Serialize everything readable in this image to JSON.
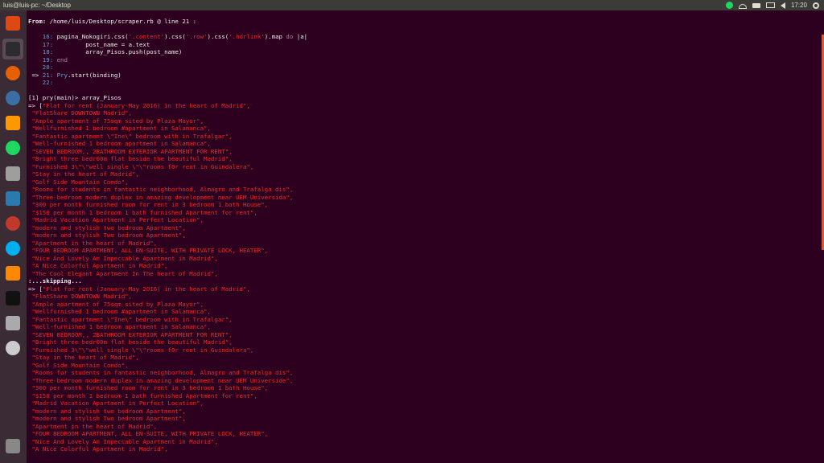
{
  "window": {
    "title": "luis@luis-pc: ~/Desktop"
  },
  "tray": {
    "clock": "17:20",
    "icons": [
      "spotify-icon",
      "wifi-icon",
      "keyboard-icon",
      "battery-icon",
      "volume-icon",
      "gear-icon"
    ]
  },
  "launcher": {
    "items": [
      {
        "name": "ubuntu-dash-icon",
        "color": "#dd4814"
      },
      {
        "name": "terminal-icon",
        "color": "#2c2c2c"
      },
      {
        "name": "firefox-icon",
        "color": "#e66000"
      },
      {
        "name": "thunderbird-icon",
        "color": "#3b6ea5"
      },
      {
        "name": "sublime-text-icon",
        "color": "#ff9800"
      },
      {
        "name": "spotify-icon",
        "color": "#1ed760"
      },
      {
        "name": "files-icon",
        "color": "#9e9e9e"
      },
      {
        "name": "libreoffice-writer-icon",
        "color": "#2a7ab0"
      },
      {
        "name": "settings-icon",
        "color": "#c0392b"
      },
      {
        "name": "skype-icon",
        "color": "#00aff0"
      },
      {
        "name": "vlc-icon",
        "color": "#ff8800"
      },
      {
        "name": "inkscape-icon",
        "color": "#111111"
      },
      {
        "name": "drive-icon",
        "color": "#aaaaaa"
      },
      {
        "name": "dvd-icon",
        "color": "#cccccc"
      },
      {
        "name": "trash-icon",
        "color": "#888888"
      }
    ]
  },
  "terminal": {
    "from_label": "From: ",
    "from_path": "/home/luis/Desktop/scraper.rb @ line 21 :",
    "code": [
      {
        "num": "    16:",
        "a": " pagina_Nokogiri.css(",
        "s1": "'.content'",
        "b": ").css(",
        "s2": "'.row'",
        "c": ").css(",
        "s3": "'.hdrlink'",
        "d": ").map ",
        "kw": "do",
        "e": " |a|"
      },
      {
        "num": "    17:",
        "text": "         post_name = a.text"
      },
      {
        "num": "    18:",
        "text": "         array_Pisos.push(post_name)"
      },
      {
        "num": "    19:",
        "kwonly": " end"
      },
      {
        "num": "    20:",
        "text": ""
      },
      {
        "arrow": " => ",
        "num": "21:",
        "call": " Pry",
        "rest": ".start(binding)"
      },
      {
        "num": "    22:",
        "text": ""
      }
    ],
    "prompt": "[1] pry(main)> array_Pisos",
    "result_open": "=> [",
    "skipping": ":...skipping...",
    "items_first": [
      "\"Flat for rent (January-May 2016) in the heart of Madrid\",",
      " \"FlatShare DOWNTOWN Madrid\",",
      " \"Ample apartment of 75sqm sited by Plaza Mayor\",",
      " \"Wellfurnished 1 bedroom #apartment in Salamanca\",",
      " \"Fantastic apartment \\\"Ine\\\" bedroom with in Trafalgar\",",
      " \"Well-furnished 1 bedroom apartment in Salamanca\",",
      " \"SEVEN BEDROOM,, 2BATHROOM EXTERIOR APARTMENT FOR RENT\",",
      " \"Bright three bedr00m flat beside the beautiful Madrid\",",
      " \"Furnished 3\\\"\\\"well single \\\"\\\"rooms f0r rent in Guindalera\",",
      " \"Stay in the heart of Madrid\",",
      " \"Golf Side Mountain Condo\",",
      " \"Rooms for students in fantastic neighborhood, Almagro and Trafalga dis\",",
      " \"Three-bedroom modern duplex in amazing development near UEM Universida\",",
      " \"300 per month furnished room for rent in 3 bedroom 1 bath House\",",
      " \"$150 per month 1 bedroom 1 bath furnished Apartment for rent\",",
      " \"Madrid Vacation Apartment in Perfect Location\",",
      " \"modern and stylish two bedroom Apartment\",",
      " \"modern and stylish Two bedroom Apartment\",",
      " \"Apartment in the heart of Madrid\",",
      " \"FOUR BEDROOM APARTMENT, ALL EN-SUITE, WITH PRIVATE LOCK, HEATER\",",
      " \"Nice And Lovely An Impeccable Apartment in Madrid\",",
      " \"A Nice Colorful Apartment in Madrid\",",
      " \"The Cool Elegant Apartment In The heart of Madrid\","
    ],
    "items_second": [
      "\"Flat for rent (January-May 2016) in the heart of Madrid\",",
      " \"FlatShare DOWNTOWN Madrid\",",
      " \"Ample apartment of 75sqm sited by Plaza Mayor\",",
      " \"Wellfurnished 1 bedroom #apartment in Salamanca\",",
      " \"Fantastic apartment \\\"Ine\\\" bedroom with in Trafalgar\",",
      " \"Well-furnished 1 bedroom apartment in Salamanca\",",
      " \"SEVEN BEDROOM,, 2BATHROOM EXTERIOR APARTMENT FOR RENT\",",
      " \"Bright three bedr00m flat beside the beautiful Madrid\",",
      " \"Furnished 3\\\"\\\"well single \\\"\\\"rooms f0r rent in Guindalera\",",
      " \"Stay in the heart of Madrid\",",
      " \"Golf Side Mountain Condo\",",
      " \"Rooms for students in fantastic neighborhood, Almagro and Trafalga dis\",",
      " \"Three-bedroom modern duplex in amazing development near UEM Universide\",",
      " \"300 per month furnished room for rent in 3 bedroom 1 bath House\",",
      " \"$150 per month 1 bedroom 1 bath furnished Apartment for rent\",",
      " \"Madrid Vacation Apartment in Perfect Location\",",
      " \"modern and stylish two bedroom Apartment\",",
      " \"modern and stylish Two bedroom Apartment\",",
      " \"Apartment in the heart of Madrid\",",
      " \"FOUR BEDROOM APARTMENT, ALL EN-SUITE, WITH PRIVATE LOCK, HEATER\",",
      " \"Nice And Lovely An Impeccable Apartment in Madrid\",",
      " \"A Nice Colorful Apartment in Madrid\","
    ]
  },
  "colors": {
    "accent": "#e95420",
    "string": "#ef2929",
    "bg": "#2c001e"
  }
}
